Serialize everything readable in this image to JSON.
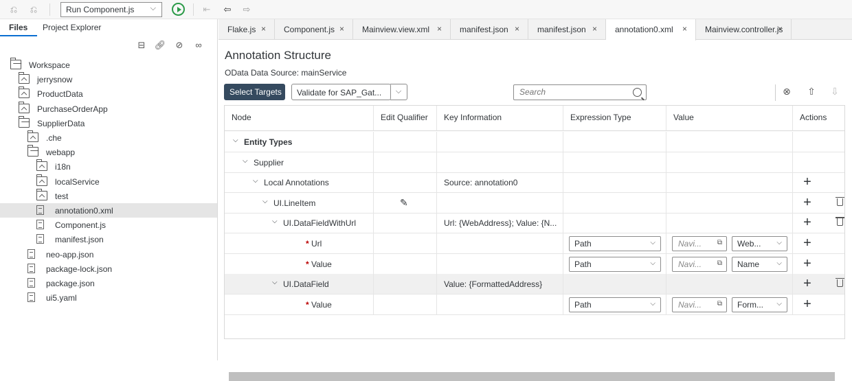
{
  "toolbar": {
    "run_config": "Run Component.js",
    "icons": [
      "undo-icon",
      "redo-icon",
      "run-icon",
      "go-back-icon",
      "back-icon",
      "forward-icon"
    ]
  },
  "left_panel": {
    "tabs": [
      "Files",
      "Project Explorer"
    ],
    "tools": [
      "new-folder-icon",
      "link-icon",
      "hide-icon",
      "binoculars-icon"
    ],
    "tree": [
      {
        "label": "Workspace",
        "kind": "folder-open",
        "depth": 0
      },
      {
        "label": "jerrysnow",
        "kind": "folder",
        "depth": 1
      },
      {
        "label": "ProductData",
        "kind": "folder",
        "depth": 1
      },
      {
        "label": "PurchaseOrderApp",
        "kind": "folder",
        "depth": 1
      },
      {
        "label": "SupplierData",
        "kind": "folder-open",
        "depth": 1
      },
      {
        "label": ".che",
        "kind": "folder",
        "depth": 2
      },
      {
        "label": "webapp",
        "kind": "folder-open",
        "depth": 2
      },
      {
        "label": "i18n",
        "kind": "folder",
        "depth": 3
      },
      {
        "label": "localService",
        "kind": "folder",
        "depth": 3
      },
      {
        "label": "test",
        "kind": "folder",
        "depth": 3
      },
      {
        "label": "annotation0.xml",
        "kind": "file",
        "depth": 3,
        "selected": true
      },
      {
        "label": "Component.js",
        "kind": "file",
        "depth": 3
      },
      {
        "label": "manifest.json",
        "kind": "file",
        "depth": 3
      },
      {
        "label": "neo-app.json",
        "kind": "file",
        "depth": 2
      },
      {
        "label": "package-lock.json",
        "kind": "file",
        "depth": 2
      },
      {
        "label": "package.json",
        "kind": "file",
        "depth": 2
      },
      {
        "label": "ui5.yaml",
        "kind": "file",
        "depth": 2
      }
    ]
  },
  "editor_tabs": [
    {
      "label": "Flake.js",
      "close": "×"
    },
    {
      "label": "Component.js",
      "close": "×"
    },
    {
      "label": "Mainview.view.xml",
      "close": "×"
    },
    {
      "label": "manifest.json",
      "close": "×"
    },
    {
      "label": "manifest.json",
      "close": "×"
    },
    {
      "label": "annotation0.xml",
      "close": "×",
      "active": true
    },
    {
      "label": "Mainview.controller.js",
      "close": "×"
    }
  ],
  "editor": {
    "title": "Annotation Structure",
    "datasource": "OData Data Source: mainService",
    "select_targets": "Select Targets",
    "validate": "Validate for SAP_Gat...",
    "search_placeholder": "Search",
    "columns": [
      "Node",
      "Edit Qualifier",
      "Key Information",
      "Expression Type",
      "Value",
      "Actions"
    ],
    "rows": [
      {
        "node": "Entity Types",
        "bold": true,
        "indent": 0
      },
      {
        "node": "Supplier",
        "indent": 1
      },
      {
        "node": "Local Annotations",
        "indent": 2,
        "key": "Source: annotation0",
        "plus": true
      },
      {
        "node": "UI.LineItem",
        "indent": 3,
        "qualifier_icon": "edit-icon",
        "plus": true,
        "trash": true
      },
      {
        "node": "UI.DataFieldWithUrl",
        "indent": 4,
        "key": "Url: {WebAddress}; Value: {N...",
        "plus": true,
        "trash": true
      },
      {
        "node": "Url",
        "required": true,
        "indent": 5,
        "expr": "Path",
        "nav": "Navi...",
        "val": "Web...",
        "plus": true
      },
      {
        "node": "Value",
        "required": true,
        "indent": 5,
        "expr": "Path",
        "nav": "Navi...",
        "val": "Name",
        "plus": true
      },
      {
        "node": "UI.DataField",
        "indent": 4,
        "key": "Value: {FormattedAddress}",
        "plus": true,
        "trash": true,
        "highlight": true
      },
      {
        "node": "Value",
        "required": true,
        "indent": 5,
        "expr": "Path",
        "nav": "Navi...",
        "val": "Form...",
        "plus": true
      }
    ]
  },
  "colors": {
    "primary_button": "#354a5f",
    "run_green": "#2b9a48",
    "required": "#bb0000"
  }
}
